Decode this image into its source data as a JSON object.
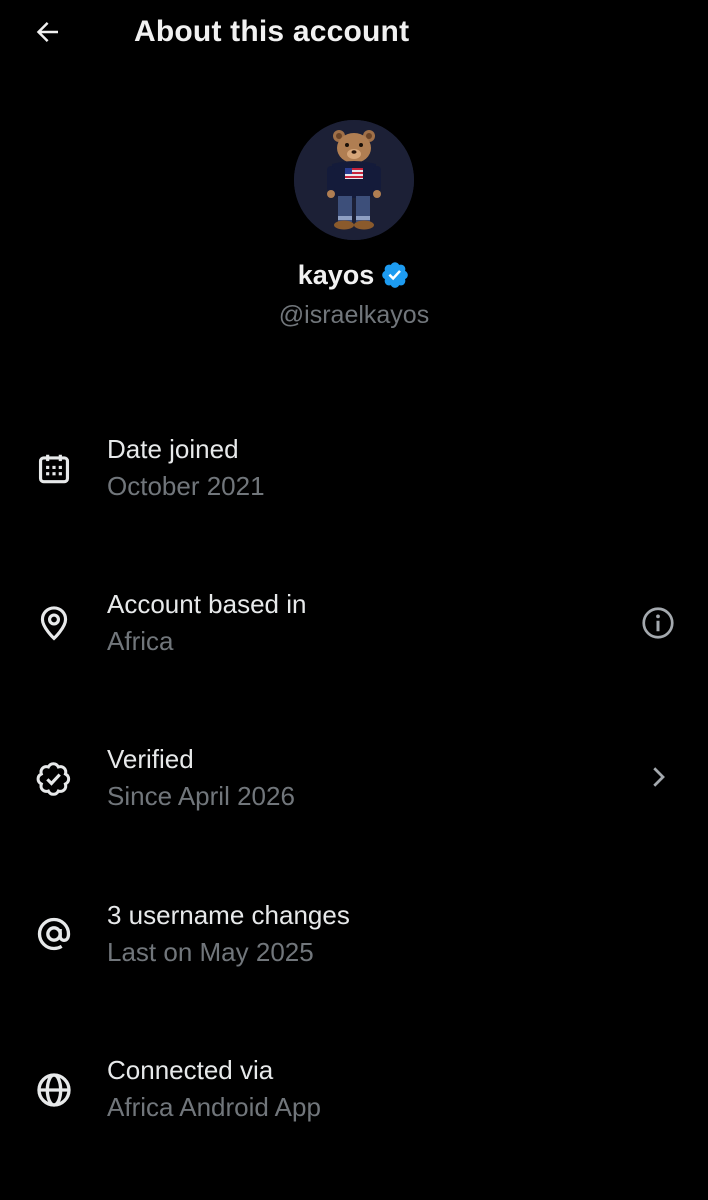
{
  "header": {
    "title": "About this account",
    "back_icon": "arrow-left-icon"
  },
  "profile": {
    "display_name": "kayos",
    "handle": "@israelkayos",
    "verified": true,
    "verified_color": "#1d9bf0",
    "avatar_icon": "teddy-bear-avatar"
  },
  "rows": [
    {
      "icon": "calendar-icon",
      "title": "Date joined",
      "subtitle": "October 2021"
    },
    {
      "icon": "location-pin-icon",
      "title": "Account based in",
      "subtitle": "Africa",
      "trailing_icon": "info-icon"
    },
    {
      "icon": "verified-badge-outline-icon",
      "title": "Verified",
      "subtitle": "Since April 2026",
      "trailing_icon": "chevron-right-icon"
    },
    {
      "icon": "at-sign-icon",
      "title": "3 username changes",
      "subtitle": "Last on May 2025"
    },
    {
      "icon": "globe-icon",
      "title": "Connected via",
      "subtitle": "Africa Android App"
    }
  ],
  "colors": {
    "background": "#000000",
    "primary_text": "#e7e9ea",
    "secondary_text": "#71767b",
    "accent": "#1d9bf0"
  }
}
